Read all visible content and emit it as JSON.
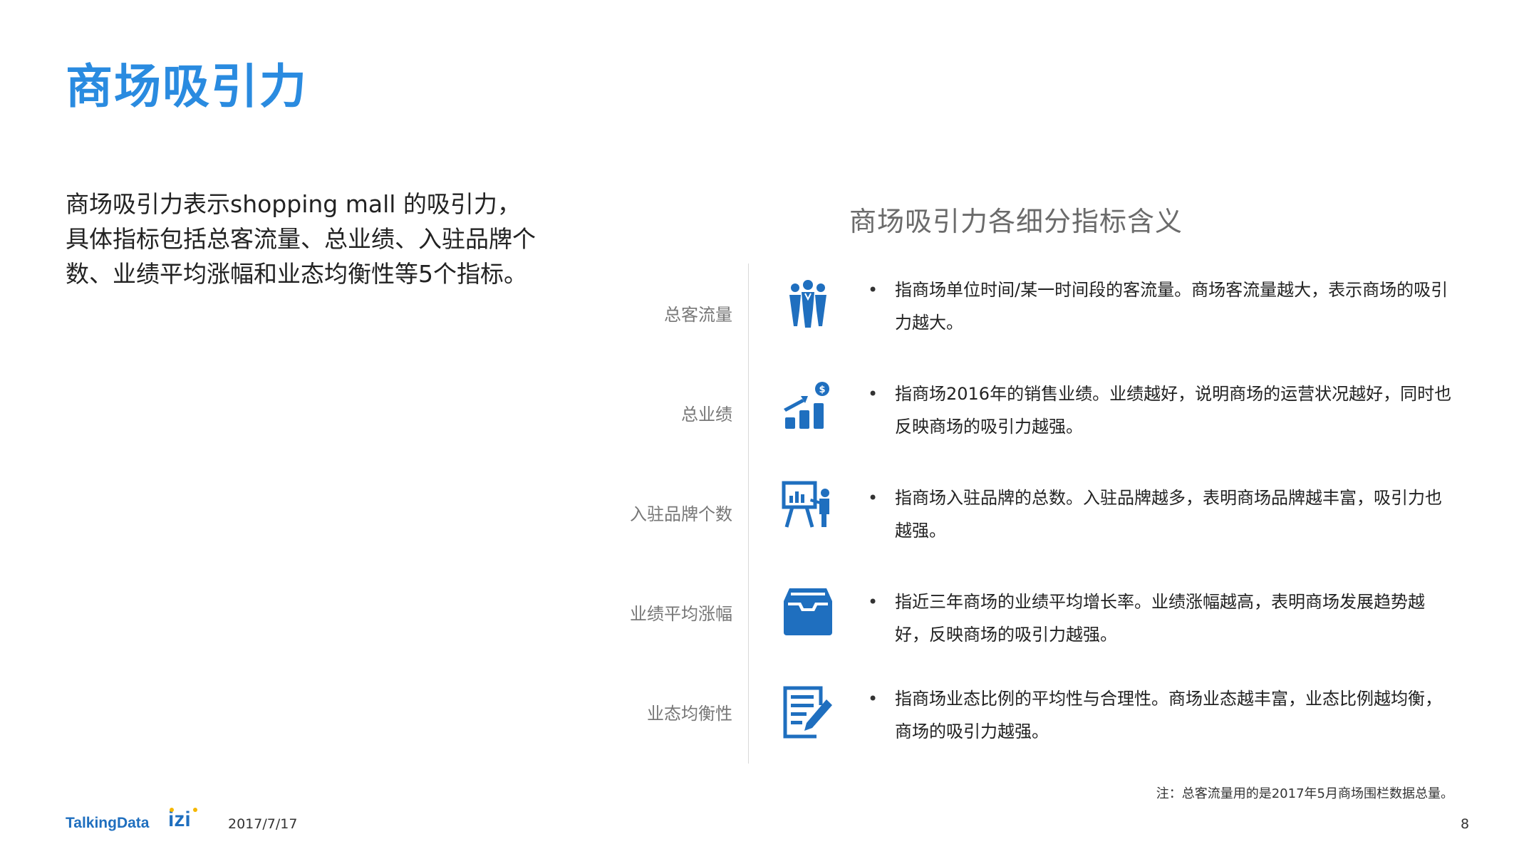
{
  "title": "商场吸引力",
  "intro": "商场吸引力表示shopping mall 的吸引力，具体指标包括总客流量、总业绩、入驻品牌个数、业绩平均涨幅和业态均衡性等5个指标。",
  "section_title": "商场吸引力各细分指标含义",
  "rows": [
    {
      "label": "总客流量",
      "icon": "crowd-icon",
      "desc": "指商场单位时间/某一时间段的客流量。商场客流量越大，表示商场的吸引力越大。"
    },
    {
      "label": "总业绩",
      "icon": "growth-chart-icon",
      "desc": "指商场2016年的销售业绩。业绩越好，说明商场的运营状况越好，同时也反映商场的吸引力越强。"
    },
    {
      "label": "入驻品牌个数",
      "icon": "presentation-icon",
      "desc": "指商场入驻品牌的总数。入驻品牌越多，表明商场品牌越丰富，吸引力也越强。"
    },
    {
      "label": "业绩平均涨幅",
      "icon": "inbox-tray-icon",
      "desc": "指近三年商场的业绩平均增长率。业绩涨幅越高，表明商场发展趋势越好，反映商场的吸引力越强。"
    },
    {
      "label": "业态均衡性",
      "icon": "document-edit-icon",
      "desc": "指商场业态比例的平均性与合理性。商场业态越丰富，业态比例越均衡，商场的吸引力越强。"
    }
  ],
  "bullet": "•",
  "note": "注：总客流量用的是2017年5月商场围栏数据总量。",
  "footer": {
    "logo": "TalkingData",
    "izi_logo": "izi",
    "date": "2017/7/17",
    "page_number": "8"
  },
  "colors": {
    "title": "#2a8be0",
    "icon": "#1f6fbf"
  }
}
